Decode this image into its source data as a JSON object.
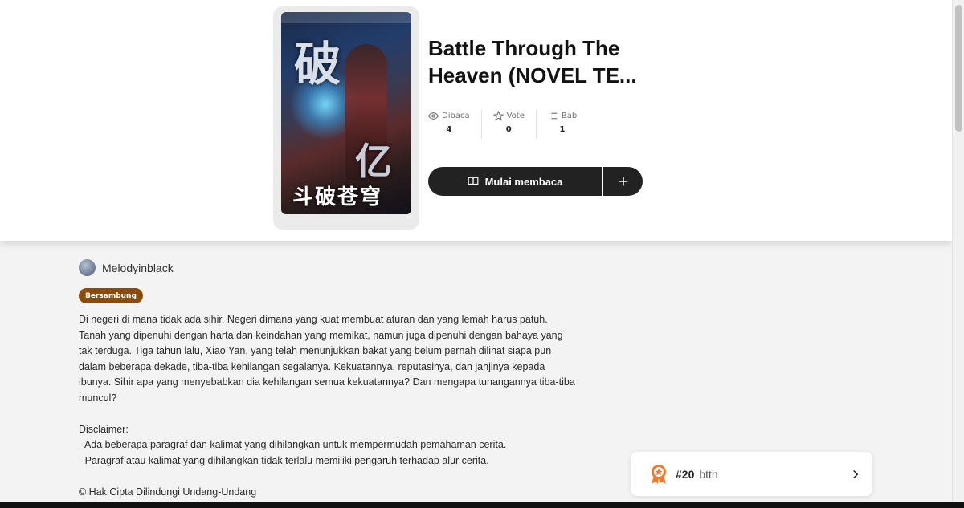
{
  "book": {
    "title": "Battle Through The Heaven (NOVEL TE...",
    "cover_glyphs": [
      "破",
      "亿",
      "斗破苍穹"
    ]
  },
  "stats": [
    {
      "icon": "eye-icon",
      "label": "Dibaca",
      "value": "4"
    },
    {
      "icon": "star-icon",
      "label": "Vote",
      "value": "0"
    },
    {
      "icon": "list-icon",
      "label": "Bab",
      "value": "1"
    }
  ],
  "actions": {
    "read_label": "Mulai membaca",
    "add_icon": "plus-icon"
  },
  "author": {
    "name": "Melodyinblack"
  },
  "status": {
    "label": "Bersambung",
    "color": "#8a4b0c"
  },
  "description": {
    "paragraph1": "Di negeri di mana tidak ada sihir. Negeri dimana yang kuat membuat aturan dan yang lemah harus patuh. Tanah yang dipenuhi dengan harta dan keindahan yang memikat, namun juga dipenuhi dengan bahaya yang tak terduga. Tiga tahun lalu, Xiao Yan, yang telah menunjukkan bakat yang belum pernah dilihat siapa pun dalam beberapa dekade, tiba-tiba kehilangan segalanya. Kekuatannya, reputasinya, dan janjinya kepada ibunya. Sihir apa yang menyebabkan dia kehilangan semua kekuatannya? Dan mengapa tunangannya tiba-tiba muncul?",
    "disclaimer_title": "Disclaimer:",
    "disclaimer_line1": "- Ada beberapa paragraf dan kalimat yang dihilangkan untuk mempermudah pemahaman cerita.",
    "disclaimer_line2": "- Paragraf atau kalimat yang dihilangkan tidak terlalu memiliki pengaruh terhadap alur cerita.",
    "copyright": "© Hak Cipta Dilindungi Undang-Undang"
  },
  "ranking": {
    "rank": "#20",
    "tag": "btth",
    "medal_color": "#f07a2e"
  },
  "colors": {
    "button_bg": "#222222",
    "page_bg": "#f3f3f3"
  }
}
